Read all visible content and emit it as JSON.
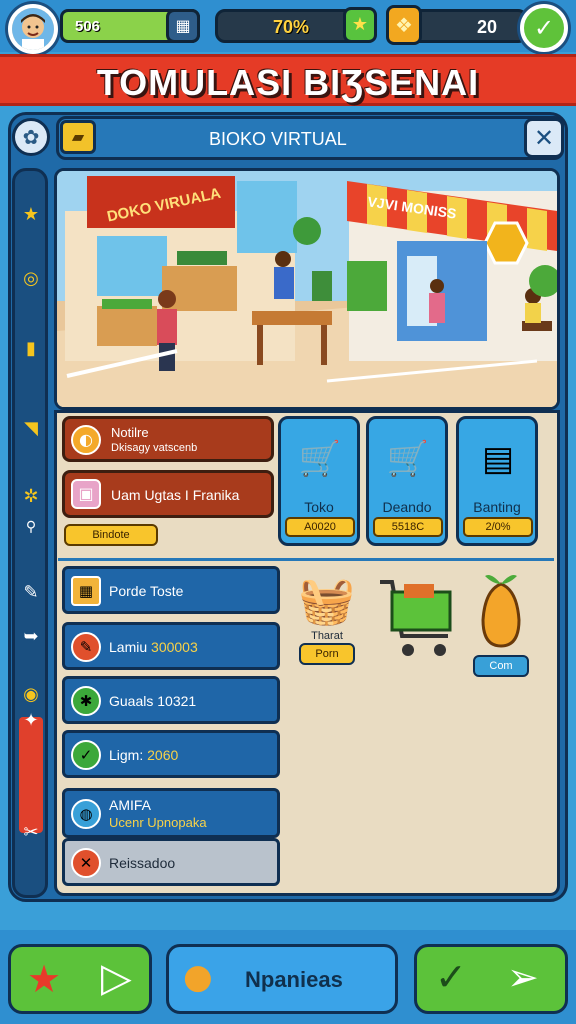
{
  "hud": {
    "level_value": "506",
    "progress_percent": "70%",
    "coins": "20"
  },
  "title": "TOMULASI BIƷSENAI",
  "header": {
    "title": "BIOKO VIRTUAL"
  },
  "scene": {
    "sign_left": "DOKO VIRUALA",
    "sign_right": "VJVI MONISS"
  },
  "actions": [
    {
      "line1": "Notilre",
      "line2": "Dkisagy vatscenb"
    },
    {
      "line1": "Uam Ugtas I Franika",
      "line2": ""
    }
  ],
  "small_button": "Bindote",
  "cards": [
    {
      "name": "Toko",
      "price": "A0020"
    },
    {
      "name": "Deando",
      "price": "5518C"
    },
    {
      "name": "Banting",
      "price": "2/0%"
    }
  ],
  "list": [
    {
      "label": "Porde Toste",
      "value": ""
    },
    {
      "label": "Lamiu",
      "value": "300003"
    },
    {
      "label": "Guaals",
      "value": "10321"
    },
    {
      "label": "Ligm:",
      "value": "2060"
    },
    {
      "label": "AMIFA",
      "value": "Ucenr Upnopaka"
    },
    {
      "label": "Reissadoo",
      "value": ""
    }
  ],
  "items": [
    {
      "name": "Tharat",
      "badge": "Porn"
    },
    {
      "name": "",
      "badge": ""
    },
    {
      "name": "",
      "badge": "Com"
    }
  ],
  "bottom": {
    "center_label": "Npanieas"
  }
}
